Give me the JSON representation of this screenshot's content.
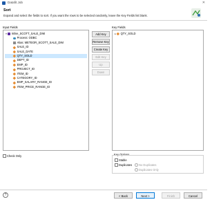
{
  "window": {
    "title": "Datafit Job"
  },
  "header": {
    "title": "Sort",
    "description": "Expand and select the fields to sort. If you want the rows to be selected randomly, leave the Key Fields list blank."
  },
  "input_fields": {
    "label": "Input Fields",
    "tree": [
      {
        "text": "Inline_SCOTT_SALE_DIM",
        "icon": "component-icon",
        "level": 0,
        "expander": "▾"
      },
      {
        "text": "Process: ODBC",
        "icon": "db-icon",
        "level": 1
      },
      {
        "text": "Alias: METEOR_SCOTT_SALE_DIM",
        "icon": "doc-icon",
        "level": 1
      },
      {
        "text": "SALE_ID",
        "icon": "field-icon",
        "level": 1
      },
      {
        "text": "SALE_DATE",
        "icon": "field-icon",
        "level": 1
      },
      {
        "text": "QTY_SOLD",
        "icon": "field-icon",
        "level": 1,
        "selected": true
      },
      {
        "text": "DEPT_ID",
        "icon": "field-icon",
        "level": 1
      },
      {
        "text": "EMP_ID",
        "icon": "field-icon",
        "level": 1
      },
      {
        "text": "PROJECT_ID",
        "icon": "field-icon",
        "level": 1
      },
      {
        "text": "ITEM_ID",
        "icon": "field-icon",
        "level": 1
      },
      {
        "text": "CATEGORY_ID",
        "icon": "field-icon",
        "level": 1
      },
      {
        "text": "EMP_SALARY_RANGE_ID",
        "icon": "field-icon",
        "level": 1
      },
      {
        "text": "ITEM_PRICE_RANGE_ID",
        "icon": "field-icon",
        "level": 1
      }
    ]
  },
  "key_fields": {
    "label": "Key Fields",
    "tree": [
      {
        "text": "QTY_SOLD",
        "icon": "field-icon",
        "level": 0,
        "expander": "▸"
      }
    ]
  },
  "buttons": {
    "add_key": "Add Key",
    "remove_key": "Remove Key",
    "create_key": "Create Key",
    "edit_key": "Edit Key",
    "up": "Up",
    "down": "Down"
  },
  "check_only": {
    "label": "Check Only",
    "checked": false
  },
  "key_options": {
    "label": "Key Options",
    "stable_label": "Stable",
    "duplicates_label": "Duplicates",
    "no_duplicates_label": "No Duplicates",
    "duplicates_only_label": "Duplicates Only"
  },
  "footer": {
    "help": "?",
    "back": "< Back",
    "next": "Next >",
    "finish": "Finish",
    "cancel": "Cancel"
  },
  "colors": {
    "accent": "#0078d7",
    "selection": "#cce8ff",
    "field_icon": "#e58a2e",
    "component_icon": "#5b2aa0"
  }
}
